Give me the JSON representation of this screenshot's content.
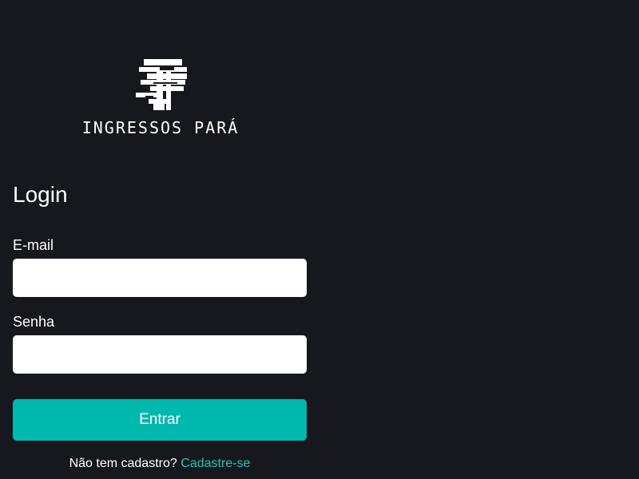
{
  "brand": {
    "name": "INGRESSOS PARÁ",
    "logo_icon": "glitch-p-logo"
  },
  "login": {
    "title": "Login",
    "email_label": "E-mail",
    "email_value": "",
    "email_placeholder": "",
    "password_label": "Senha",
    "password_value": "",
    "password_placeholder": "",
    "submit_label": "Entrar",
    "signup_prompt": "Não tem cadastro?",
    "signup_link": "Cadastre-se"
  },
  "colors": {
    "background": "#17181d",
    "accent": "#00b8ad",
    "link": "#1fc7ba",
    "text": "#ffffff",
    "input_background": "#ffffff"
  }
}
